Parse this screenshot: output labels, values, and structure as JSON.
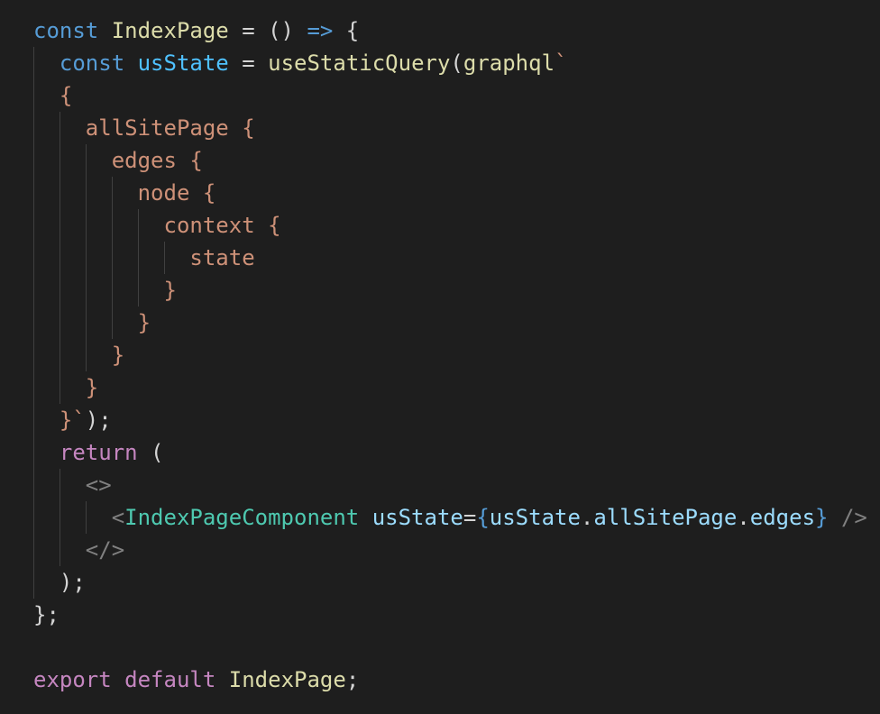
{
  "theme": {
    "background": "#1e1e1e",
    "default_text": "#d4d4d4",
    "indent_guide": "#404040"
  },
  "code_lines": [
    [
      {
        "t": "const",
        "c": "#569cd6"
      },
      {
        "t": " ",
        "c": "#d4d4d4"
      },
      {
        "t": "IndexPage",
        "c": "#dcdcaa"
      },
      {
        "t": " = () ",
        "c": "#d4d4d4"
      },
      {
        "t": "=>",
        "c": "#569cd6"
      },
      {
        "t": " {",
        "c": "#d4d4d4"
      }
    ],
    [
      {
        "t": "  ",
        "c": "#d4d4d4"
      },
      {
        "t": "const",
        "c": "#569cd6"
      },
      {
        "t": " ",
        "c": "#d4d4d4"
      },
      {
        "t": "usState",
        "c": "#4fc1ff"
      },
      {
        "t": " = ",
        "c": "#d4d4d4"
      },
      {
        "t": "useStaticQuery",
        "c": "#dcdcaa"
      },
      {
        "t": "(",
        "c": "#d4d4d4"
      },
      {
        "t": "graphql",
        "c": "#dcdcaa"
      },
      {
        "t": "`",
        "c": "#ce9178"
      }
    ],
    [
      {
        "t": "  {",
        "c": "#ce9178"
      }
    ],
    [
      {
        "t": "    allSitePage {",
        "c": "#ce9178"
      }
    ],
    [
      {
        "t": "      edges {",
        "c": "#ce9178"
      }
    ],
    [
      {
        "t": "        node {",
        "c": "#ce9178"
      }
    ],
    [
      {
        "t": "          context {",
        "c": "#ce9178"
      }
    ],
    [
      {
        "t": "            state",
        "c": "#ce9178"
      }
    ],
    [
      {
        "t": "          }",
        "c": "#ce9178"
      }
    ],
    [
      {
        "t": "        }",
        "c": "#ce9178"
      }
    ],
    [
      {
        "t": "      }",
        "c": "#ce9178"
      }
    ],
    [
      {
        "t": "    }",
        "c": "#ce9178"
      }
    ],
    [
      {
        "t": "  }`",
        "c": "#ce9178"
      },
      {
        "t": ");",
        "c": "#d4d4d4"
      }
    ],
    [
      {
        "t": "  ",
        "c": "#d4d4d4"
      },
      {
        "t": "return",
        "c": "#c586c0"
      },
      {
        "t": " (",
        "c": "#d4d4d4"
      }
    ],
    [
      {
        "t": "    ",
        "c": "#d4d4d4"
      },
      {
        "t": "<>",
        "c": "#808080"
      }
    ],
    [
      {
        "t": "      ",
        "c": "#d4d4d4"
      },
      {
        "t": "<",
        "c": "#808080"
      },
      {
        "t": "IndexPageComponent",
        "c": "#4ec9b0"
      },
      {
        "t": " ",
        "c": "#d4d4d4"
      },
      {
        "t": "usState",
        "c": "#9cdcfe"
      },
      {
        "t": "=",
        "c": "#d4d4d4"
      },
      {
        "t": "{",
        "c": "#569cd6"
      },
      {
        "t": "usState",
        "c": "#9cdcfe"
      },
      {
        "t": ".",
        "c": "#d4d4d4"
      },
      {
        "t": "allSitePage",
        "c": "#9cdcfe"
      },
      {
        "t": ".",
        "c": "#d4d4d4"
      },
      {
        "t": "edges",
        "c": "#9cdcfe"
      },
      {
        "t": "}",
        "c": "#569cd6"
      },
      {
        "t": " ",
        "c": "#d4d4d4"
      },
      {
        "t": "/>",
        "c": "#808080"
      }
    ],
    [
      {
        "t": "    ",
        "c": "#d4d4d4"
      },
      {
        "t": "</>",
        "c": "#808080"
      }
    ],
    [
      {
        "t": "  );",
        "c": "#d4d4d4"
      }
    ],
    [
      {
        "t": "};",
        "c": "#d4d4d4"
      }
    ],
    [],
    [
      {
        "t": "export",
        "c": "#c586c0"
      },
      {
        "t": " ",
        "c": "#d4d4d4"
      },
      {
        "t": "default",
        "c": "#c586c0"
      },
      {
        "t": " ",
        "c": "#d4d4d4"
      },
      {
        "t": "IndexPage",
        "c": "#dcdcaa"
      },
      {
        "t": ";",
        "c": "#d4d4d4"
      }
    ]
  ]
}
